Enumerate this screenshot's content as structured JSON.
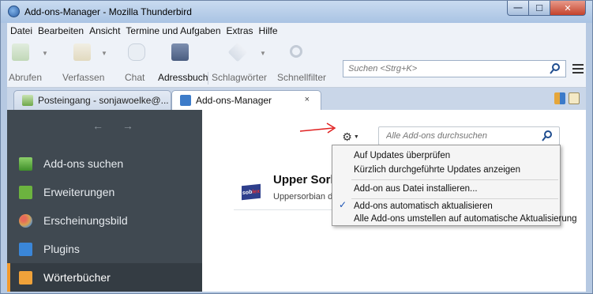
{
  "window": {
    "title": "Add-ons-Manager - Mozilla Thunderbird",
    "btn_min": "—",
    "btn_max": "☐",
    "btn_close": "✕"
  },
  "menubar": {
    "items": [
      "Datei",
      "Bearbeiten",
      "Ansicht",
      "Termine und Aufgaben",
      "Extras",
      "Hilfe"
    ]
  },
  "toolbar": {
    "get_messages": "Abrufen",
    "compose": "Verfassen",
    "chat": "Chat",
    "address_book": "Adressbuch",
    "tags": "Schlagwörter",
    "quick_filter": "Schnellfilter",
    "search_placeholder": "Suchen <Strg+K>"
  },
  "tabs": {
    "inbox_label": "Posteingang - sonjawoelke@...",
    "addons_label": "Add-ons-Manager",
    "close": "×"
  },
  "sidebar": {
    "nav": "← →",
    "items": [
      {
        "label": "Add-ons suchen",
        "icon": "download-icon",
        "color": "#5aa33a"
      },
      {
        "label": "Erweiterungen",
        "icon": "puzzle-icon",
        "color": "#6cb33f"
      },
      {
        "label": "Erscheinungsbild",
        "icon": "palette-icon",
        "color": "#d8a050"
      },
      {
        "label": "Plugins",
        "icon": "plugin-icon",
        "color": "#3a86d8"
      },
      {
        "label": "Wörterbücher",
        "icon": "dictionary-icon",
        "color": "#f0a23a"
      }
    ]
  },
  "main": {
    "gear": "⚙",
    "gear_caret": "▼",
    "search_placeholder": "Alle Add-ons durchsuchen",
    "addon": {
      "logo_text": "sob",
      "logo_accent": "lex",
      "name": "Upper Sorbian",
      "description": "Uppersorbian dictionary"
    }
  },
  "dropdown": {
    "items": [
      "Auf Updates überprüfen",
      "Kürzlich durchgeführte Updates anzeigen",
      "Add-on aus Datei installieren...",
      "Add-ons automatisch aktualisieren",
      "Alle Add-ons umstellen auf automatische Aktualisierung"
    ],
    "checkmark": "✓"
  },
  "colors": {
    "sidebar_bg": "#404951",
    "selected_accent": "#f39a2c",
    "arrow_red": "#e02020"
  }
}
